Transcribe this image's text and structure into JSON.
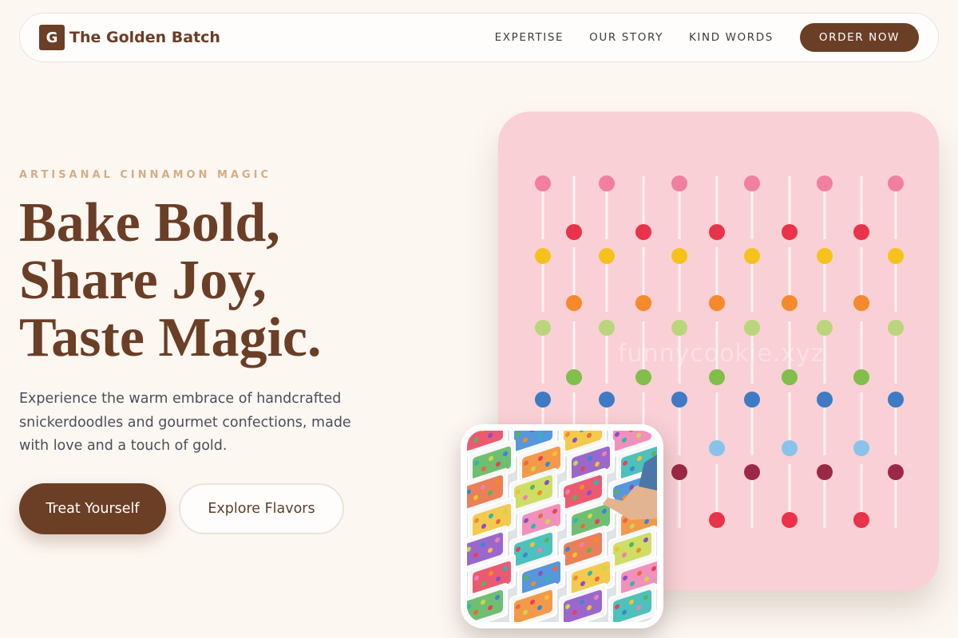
{
  "brand": {
    "mark": "G",
    "name": "The Golden Batch"
  },
  "nav": {
    "links": [
      "EXPERTISE",
      "OUR STORY",
      "KIND WORDS"
    ],
    "cta": "ORDER NOW"
  },
  "hero": {
    "eyebrow": "ARTISANAL CINNAMON MAGIC",
    "headline": [
      "Bake Bold,",
      "Share Joy,",
      "Taste Magic."
    ],
    "lede": "Experience the warm embrace of handcrafted snickerdoodles and gourmet confections, made with love and a touch of gold.",
    "primary_button": "Treat Yourself",
    "secondary_button": "Explore Flavors"
  },
  "images": {
    "main": {
      "subject": "lollipops-pattern",
      "watermark": "funnycookie.xyz"
    },
    "inset": {
      "subject": "candy-bins-photo"
    }
  },
  "colors": {
    "brand_brown": "#6b3e26",
    "background": "#fdf7f2",
    "eyebrow_gold": "#d3ad86",
    "card_pink": "#f9d0d5"
  }
}
